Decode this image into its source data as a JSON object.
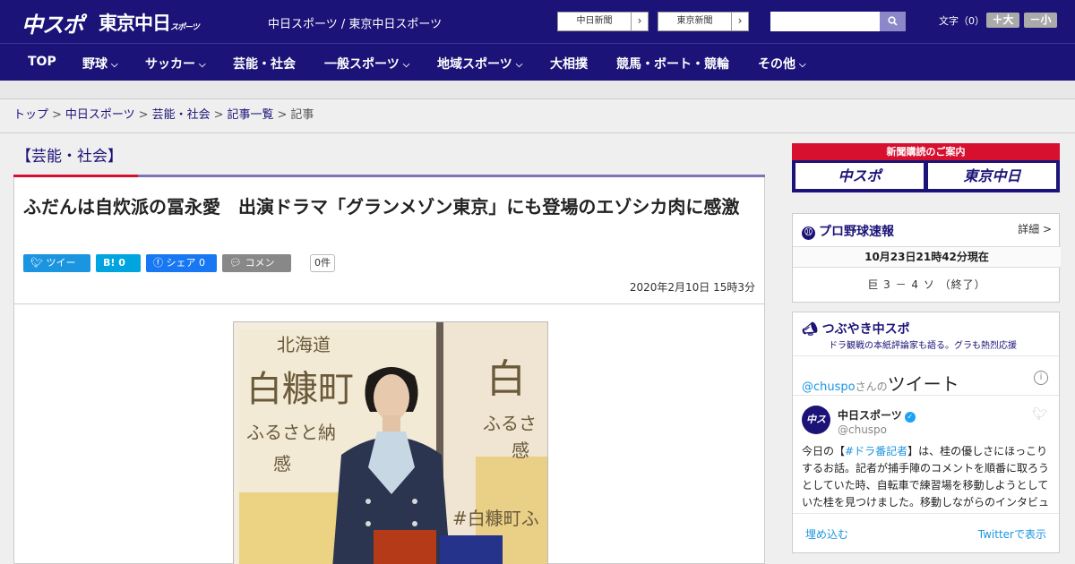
{
  "header": {
    "logo_main": "中スポ",
    "logo_tokyo": "東京中日",
    "logo_tokyo_sub": "スポーツ",
    "site_name": "中日スポーツ / 東京中日スポーツ",
    "ext_links": [
      {
        "label": "中日新聞"
      },
      {
        "label": "東京新聞"
      }
    ],
    "search_placeholder": "",
    "font_size_label": "文字（0）",
    "font_plus": "＋大",
    "font_minus": "－小"
  },
  "nav": {
    "items": [
      {
        "label": "TOP",
        "dropdown": false
      },
      {
        "label": "野球",
        "dropdown": true
      },
      {
        "label": "サッカー",
        "dropdown": true
      },
      {
        "label": "芸能・社会",
        "dropdown": false
      },
      {
        "label": "一般スポーツ",
        "dropdown": true
      },
      {
        "label": "地域スポーツ",
        "dropdown": true
      },
      {
        "label": "大相撲",
        "dropdown": false
      },
      {
        "label": "競馬・ボート・競輪",
        "dropdown": false
      },
      {
        "label": "その他",
        "dropdown": true
      }
    ]
  },
  "breadcrumb": {
    "items": [
      "トップ",
      "中日スポーツ",
      "芸能・社会",
      "記事一覧",
      "記事"
    ],
    "separator": ">"
  },
  "article": {
    "category": "【芸能・社会】",
    "title": "ふだんは自炊派の冨永愛　出演ドラマ「グランメゾン東京」にも登場のエゾシカ肉に感激",
    "share": {
      "tweet": "ツイート",
      "hatena": "B! 0",
      "facebook": "シェア 0",
      "comment": "コメント",
      "comment_count": "0件"
    },
    "date": "2020年2月10日 15時3分",
    "photo_text": {
      "line1": "北海道",
      "line2": "白糠町",
      "line3": "ふるさと納",
      "line4": "感",
      "hash": "#白糠町ふ",
      "right1": "白",
      "right2": "ふるさ",
      "right3": "感"
    }
  },
  "sidebar": {
    "subscribe": {
      "title": "新聞購読のご案内",
      "left": "中スポ",
      "right": "東京中日"
    },
    "baseball": {
      "title": "プロ野球速報",
      "detail": "詳細 >",
      "time": "10月23日21時42分現在",
      "score": "巨 3 － 4 ソ （終了）"
    },
    "tweets": {
      "title": "つぶやき中スポ",
      "subtitle": "ドラ観戦の本紙評論家も語る。グラも熱烈応援",
      "handle": "@chuspo",
      "handle_suffix": "さんの",
      "handle_tail": "ツイート",
      "name": "中日スポーツ",
      "user": "@chuspo",
      "avatar": "中スポ",
      "text_pre": "今日の【",
      "text_hash": "#ドラ番記者",
      "text_post": "】は、桂の優しさにほっこりするお話。記者が捕手陣のコメントを順番に取ろうとしていた時、自転車で練習場を移動しようとしていた桂を見つけました。移動しながらのインタビュー",
      "embed": "埋め込む",
      "view": "Twitterで表示"
    }
  },
  "colors": {
    "brand": "#1b1377",
    "accent_red": "#d8102f",
    "twitter_blue": "#1b95e0",
    "facebook_blue": "#1877f2",
    "hatena_blue": "#00a4de"
  }
}
